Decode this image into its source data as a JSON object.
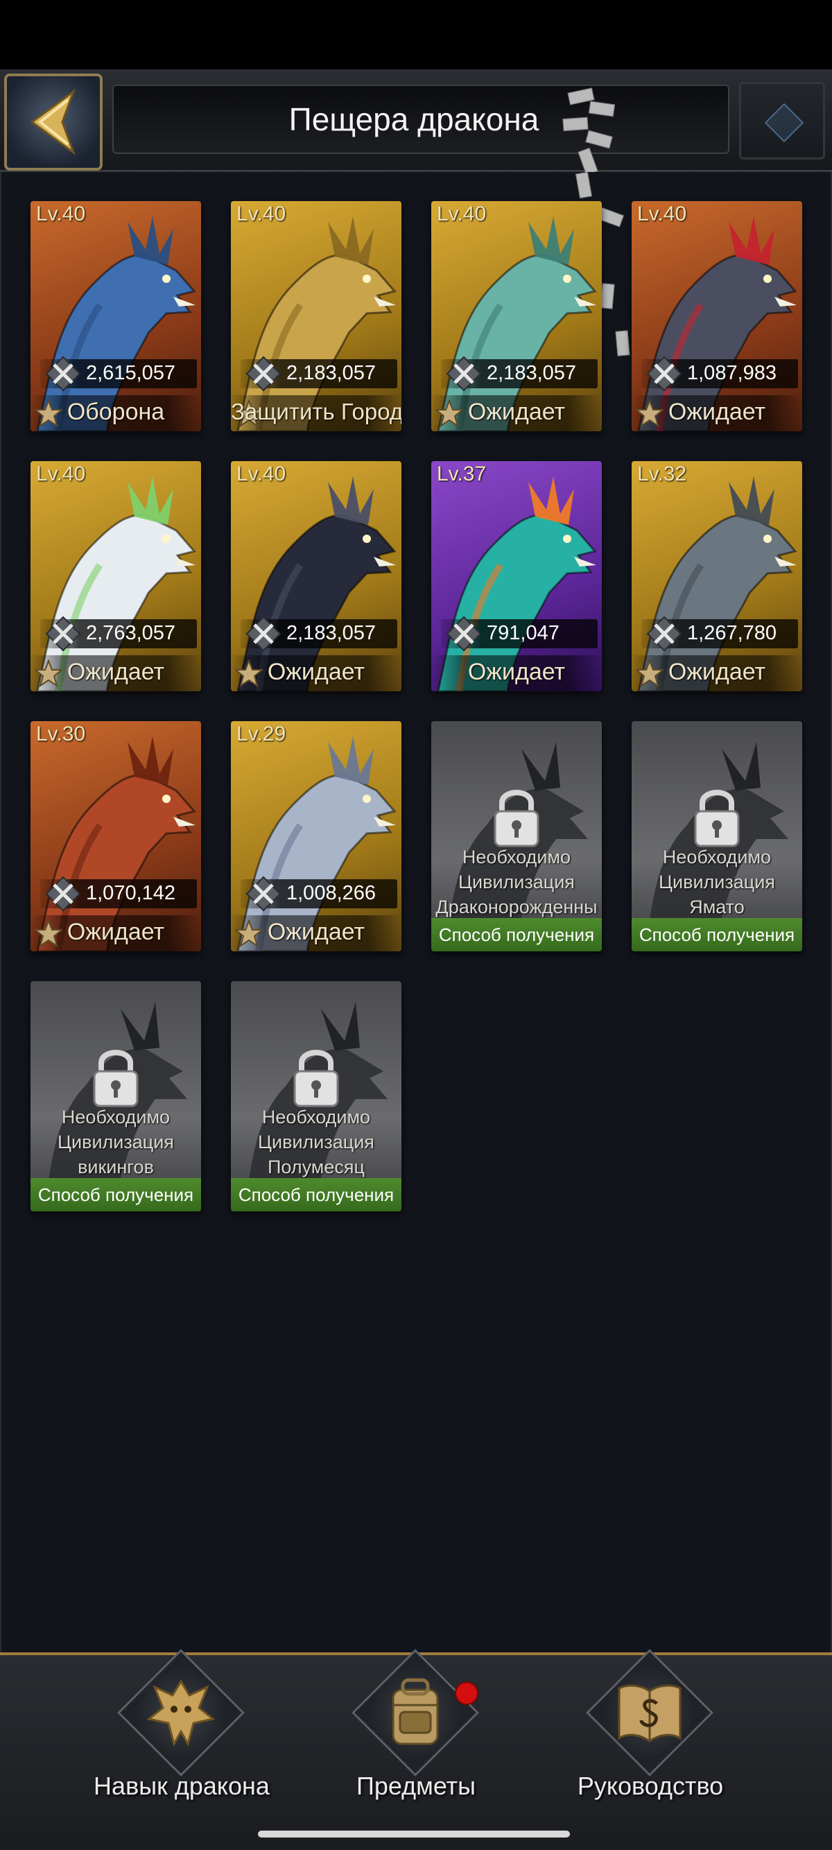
{
  "header": {
    "title": "Пещера дракона",
    "back_icon": "chevron-left-icon",
    "right_icon": "menu-emblem-icon"
  },
  "dragons": [
    {
      "level": "Lv.40",
      "power": "2,615,057",
      "status": "Оборона",
      "bg": "orange",
      "color": "#3f6fb0",
      "accent": "#2a4f82"
    },
    {
      "level": "Lv.40",
      "power": "2,183,057",
      "status": "Защитить Город",
      "bg": "gold",
      "color": "#c9a44a",
      "accent": "#8a6a22"
    },
    {
      "level": "Lv.40",
      "power": "2,183,057",
      "status": "Ожидает",
      "bg": "gold",
      "color": "#69b2a6",
      "accent": "#3d7f74"
    },
    {
      "level": "Lv.40",
      "power": "1,087,983",
      "status": "Ожидает",
      "bg": "orange",
      "color": "#4a4e60",
      "accent": "#c4242e"
    },
    {
      "level": "Lv.40",
      "power": "2,763,057",
      "status": "Ожидает",
      "bg": "gold",
      "color": "#e6ecef",
      "accent": "#7fd06a"
    },
    {
      "level": "Lv.40",
      "power": "2,183,057",
      "status": "Ожидает",
      "bg": "gold",
      "color": "#262a3a",
      "accent": "#4a4f66"
    },
    {
      "level": "Lv.37",
      "power": "791,047",
      "status": "Ожидает",
      "bg": "purple",
      "color": "#27b0a4",
      "accent": "#ee7a28"
    },
    {
      "level": "Lv.32",
      "power": "1,267,780",
      "status": "Ожидает",
      "bg": "gold",
      "color": "#6a7680",
      "accent": "#434c54"
    },
    {
      "level": "Lv.30",
      "power": "1,070,142",
      "status": "Ожидает",
      "bg": "orange",
      "color": "#b04828",
      "accent": "#6e2410"
    },
    {
      "level": "Lv.29",
      "power": "1,008,266",
      "status": "Ожидает",
      "bg": "gold",
      "color": "#a8b4c8",
      "accent": "#6a7894"
    }
  ],
  "locked": [
    {
      "line1": "Необходимо",
      "line2": "Цивилизация",
      "line3": "Драконорожденны",
      "obtain": "Способ получения"
    },
    {
      "line1": "Необходимо",
      "line2": "Цивилизация",
      "line3": "Ямато",
      "obtain": "Способ получения"
    },
    {
      "line1": "Необходимо",
      "line2": "Цивилизация",
      "line3": "викингов",
      "obtain": "Способ получения"
    },
    {
      "line1": "Необходимо",
      "line2": "Цивилизация",
      "line3": "Полумесяц",
      "obtain": "Способ получения"
    }
  ],
  "bottom_nav": [
    {
      "label": "Навык дракона",
      "icon": "dragon-skill-icon"
    },
    {
      "label": "Предметы",
      "icon": "backpack-icon",
      "notification": true
    },
    {
      "label": "Руководство",
      "icon": "guide-book-icon"
    }
  ],
  "colors": {
    "accent_gold": "#a27c3e",
    "obtain_green": "#4f8a2e",
    "notification_red": "#d40f0f"
  }
}
